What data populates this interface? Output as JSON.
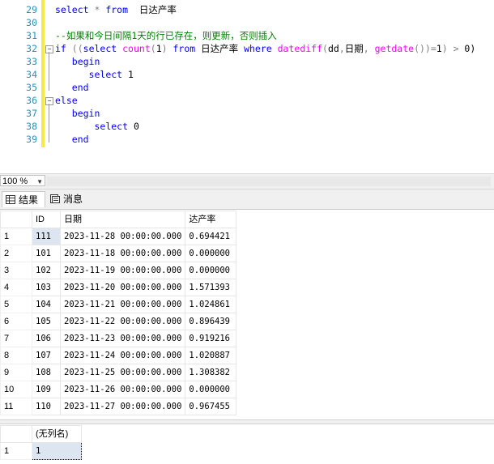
{
  "editor": {
    "lines": [
      {
        "n": "29",
        "parts": [
          [
            "kw",
            "select"
          ],
          [
            "op",
            " * "
          ],
          [
            "kw",
            "from"
          ],
          [
            "",
            "  日达产率"
          ]
        ]
      },
      {
        "n": "30",
        "parts": []
      },
      {
        "n": "31",
        "parts": [
          [
            "cm",
            "--如果和今日间隔1天的行已存在，则更新，否则插入"
          ]
        ]
      },
      {
        "n": "32",
        "parts": [
          [
            "kw",
            "if"
          ],
          [
            "op",
            " (("
          ],
          [
            "kw",
            "select"
          ],
          [
            "",
            " "
          ],
          [
            "fn",
            "count"
          ],
          [
            "op",
            "("
          ],
          [
            "",
            "1"
          ],
          [
            "op",
            ")"
          ],
          [
            "",
            " "
          ],
          [
            "kw",
            "from"
          ],
          [
            "",
            " 日达产率 "
          ],
          [
            "kw",
            "where"
          ],
          [
            "",
            " "
          ],
          [
            "fn",
            "datediff"
          ],
          [
            "op",
            "("
          ],
          [
            "",
            "dd"
          ],
          [
            "op",
            ","
          ],
          [
            "",
            "日期"
          ],
          [
            "op",
            ", "
          ],
          [
            "fn",
            "getdate"
          ],
          [
            "op",
            "())="
          ],
          [
            "",
            "1"
          ],
          [
            "op",
            ") > "
          ],
          [
            "",
            "0)"
          ]
        ]
      },
      {
        "n": "33",
        "parts": [
          [
            "",
            "   "
          ],
          [
            "kw",
            "begin"
          ]
        ]
      },
      {
        "n": "34",
        "parts": [
          [
            "",
            "      "
          ],
          [
            "kw",
            "select"
          ],
          [
            "",
            " 1"
          ]
        ]
      },
      {
        "n": "35",
        "parts": [
          [
            "",
            "   "
          ],
          [
            "kw",
            "end"
          ]
        ]
      },
      {
        "n": "36",
        "parts": [
          [
            "kw",
            "else"
          ]
        ]
      },
      {
        "n": "37",
        "parts": [
          [
            "",
            "   "
          ],
          [
            "kw",
            "begin"
          ]
        ]
      },
      {
        "n": "38",
        "parts": [
          [
            "",
            "       "
          ],
          [
            "kw",
            "select"
          ],
          [
            "",
            " 0"
          ]
        ]
      },
      {
        "n": "39",
        "parts": [
          [
            "",
            "   "
          ],
          [
            "kw",
            "end"
          ]
        ]
      }
    ]
  },
  "zoom": {
    "value": "100 %"
  },
  "tabs": {
    "results": "结果",
    "messages": "消息"
  },
  "grid1": {
    "columns": [
      "ID",
      "日期",
      "达产率"
    ],
    "rows": [
      [
        "1",
        "111",
        "2023-11-28 00:00:00.000",
        "0.694421"
      ],
      [
        "2",
        "101",
        "2023-11-18 00:00:00.000",
        "0.000000"
      ],
      [
        "3",
        "102",
        "2023-11-19 00:00:00.000",
        "0.000000"
      ],
      [
        "4",
        "103",
        "2023-11-20 00:00:00.000",
        "1.571393"
      ],
      [
        "5",
        "104",
        "2023-11-21 00:00:00.000",
        "1.024861"
      ],
      [
        "6",
        "105",
        "2023-11-22 00:00:00.000",
        "0.896439"
      ],
      [
        "7",
        "106",
        "2023-11-23 00:00:00.000",
        "0.919216"
      ],
      [
        "8",
        "107",
        "2023-11-24 00:00:00.000",
        "1.020887"
      ],
      [
        "9",
        "108",
        "2023-11-25 00:00:00.000",
        "1.308382"
      ],
      [
        "10",
        "109",
        "2023-11-26 00:00:00.000",
        "0.000000"
      ],
      [
        "11",
        "110",
        "2023-11-27 00:00:00.000",
        "0.967455"
      ]
    ]
  },
  "grid2": {
    "columns": [
      "(无列名)"
    ],
    "rows": [
      [
        "1",
        "1"
      ]
    ]
  },
  "colors": {
    "keyword": "#0000ff",
    "function": "#ff00ff",
    "comment": "#008000",
    "line_number": "#2b91af",
    "change_bar": "#f5e94a"
  }
}
